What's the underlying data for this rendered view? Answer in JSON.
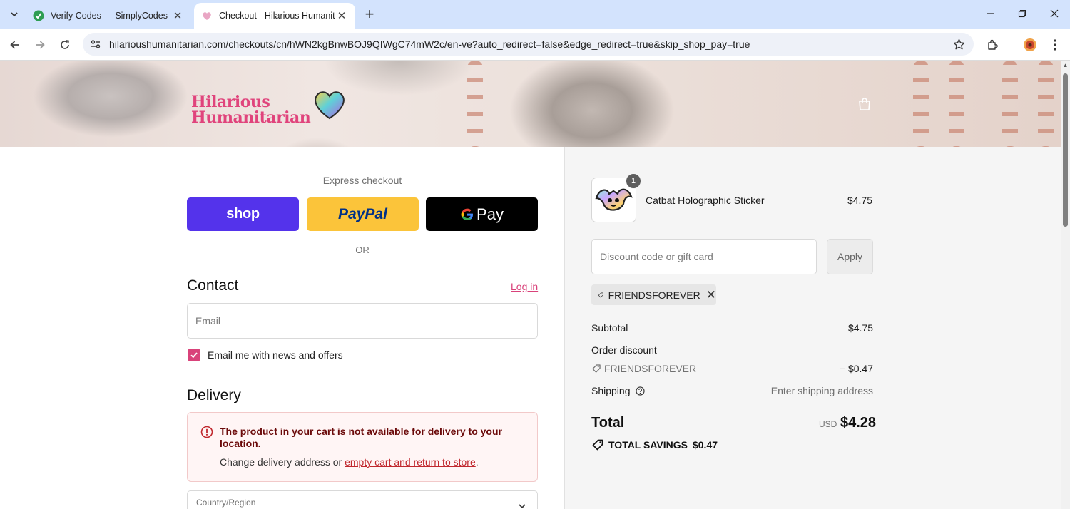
{
  "browser": {
    "tabs": [
      {
        "title": "Verify Codes — SimplyCodes",
        "active": false
      },
      {
        "title": "Checkout - Hilarious Humanitarian",
        "active": true
      }
    ],
    "url": "hilarioushumanitarian.com/checkouts/cn/hWN2kgBnwBOJ9QIWgC74mW2c/en-ve?auto_redirect=false&edge_redirect=true&skip_shop_pay=true"
  },
  "store": {
    "logo_line1": "Hilarious",
    "logo_line2": "Humanitarian"
  },
  "express": {
    "label": "Express checkout",
    "shop_label": "shop",
    "paypal_label": "PayPal",
    "gpay_label": "Pay",
    "or_label": "OR"
  },
  "contact": {
    "heading": "Contact",
    "login_label": "Log in",
    "email_placeholder": "Email",
    "email_value": "",
    "newsletter_label": "Email me with news and offers",
    "newsletter_checked": true
  },
  "delivery": {
    "heading": "Delivery",
    "alert_title": "The product in your cart is not available for delivery to your location.",
    "alert_body_prefix": "Change delivery address or ",
    "alert_link": "empty cart and return to store",
    "alert_body_suffix": ".",
    "country_label": "Country/Region"
  },
  "summary": {
    "item": {
      "name": "Catbat Holographic Sticker",
      "price": "$4.75",
      "quantity": "1"
    },
    "discount_placeholder": "Discount code or gift card",
    "discount_value": "",
    "apply_label": "Apply",
    "applied_code": "FRIENDSFOREVER",
    "subtotal_label": "Subtotal",
    "subtotal_value": "$4.75",
    "order_discount_label": "Order discount",
    "order_discount_code": "FRIENDSFOREVER",
    "order_discount_value": "− $0.47",
    "shipping_label": "Shipping",
    "shipping_value": "Enter shipping address",
    "total_label": "Total",
    "currency": "USD",
    "total_value": "$4.28",
    "savings_label": "TOTAL SAVINGS",
    "savings_value": "$0.47"
  },
  "colors": {
    "accent": "#d9427a",
    "shop_pay": "#5433eb",
    "paypal": "#fbc43a",
    "error": "#c0272d"
  }
}
